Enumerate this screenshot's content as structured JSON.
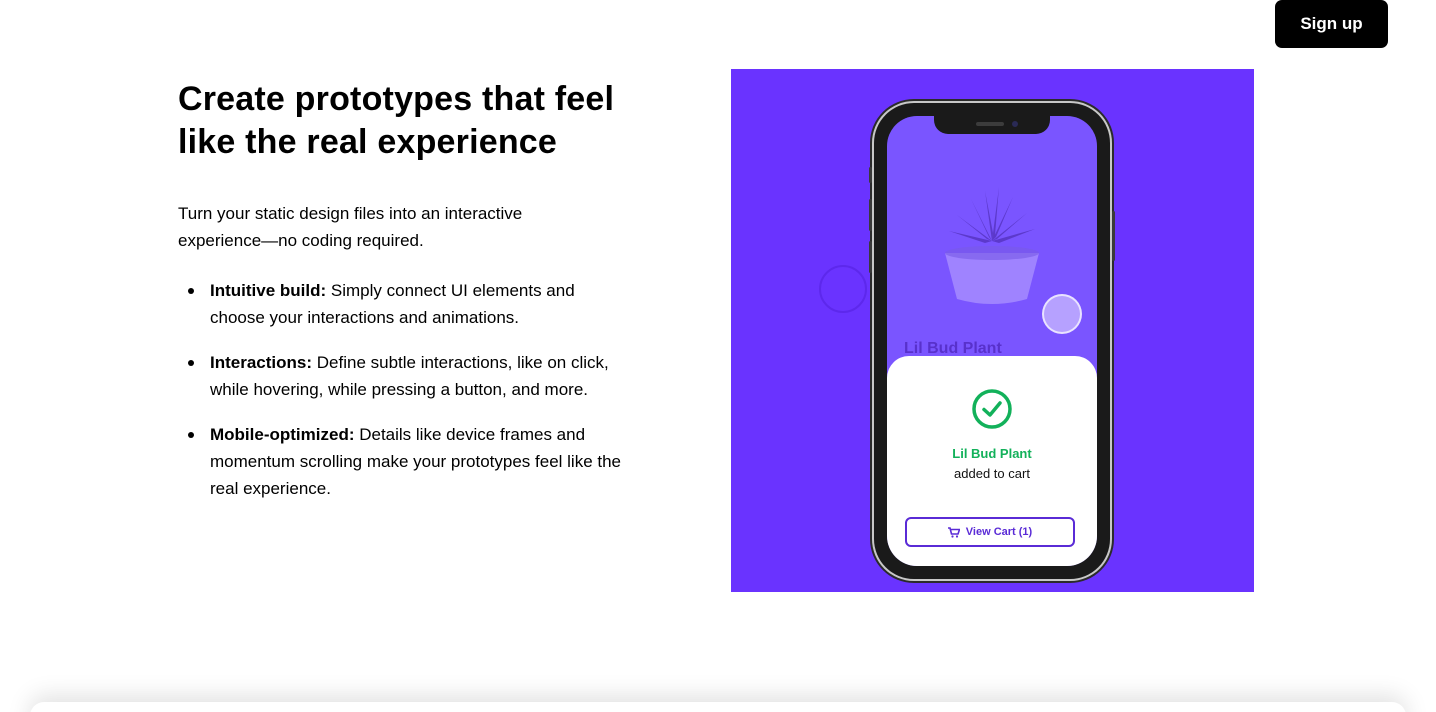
{
  "header": {
    "signup_label": "Sign up"
  },
  "content": {
    "headline": "Create prototypes that feel like the real experience",
    "intro": "Turn your static design files into an interactive experience—no coding required.",
    "features": [
      {
        "title": "Intuitive build:",
        "text": " Simply connect UI elements and choose your interactions and animations."
      },
      {
        "title": "Interactions:",
        "text": " Define subtle interactions, like on click, while hovering, while pressing a button, and more."
      },
      {
        "title": "Mobile-optimized:",
        "text": " Details like device frames and momentum scrolling make your prototypes feel like the real experience."
      }
    ]
  },
  "hero": {
    "background_color": "#6a33ff",
    "product_name_bg": "Lil Bud Plant",
    "confirm_title": "Lil Bud Plant",
    "confirm_subtitle": "added to cart",
    "cart_button_label": "View Cart (1)",
    "icons": [
      "plant-icon",
      "check-circle-icon",
      "cart-icon"
    ],
    "accent_green": "#12b15a",
    "accent_purple": "#5a2bd6"
  }
}
